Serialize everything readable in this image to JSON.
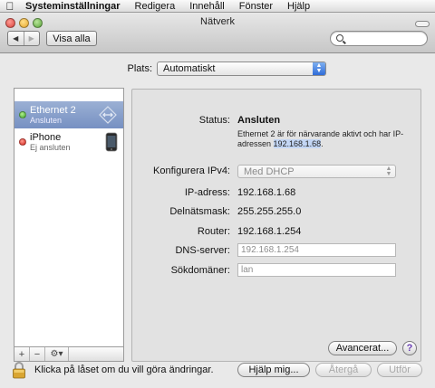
{
  "menubar": {
    "app": "Systeminställningar",
    "items": [
      "Redigera",
      "Innehåll",
      "Fönster",
      "Hjälp"
    ]
  },
  "window": {
    "title": "Nätverk",
    "show_all": "Visa alla",
    "search_placeholder": ""
  },
  "location": {
    "label": "Plats:",
    "value": "Automatiskt"
  },
  "services": [
    {
      "name": "Ethernet 2",
      "status": "Ansluten",
      "state": "connected",
      "selected": true,
      "icon": "ethernet-icon"
    },
    {
      "name": "iPhone",
      "status": "Ej ansluten",
      "state": "disconnected",
      "selected": false,
      "icon": "iphone-icon"
    }
  ],
  "sidebar_controls": {
    "add": "+",
    "remove": "−",
    "action": "⚙▾"
  },
  "detail": {
    "status_label": "Status:",
    "status_value": "Ansluten",
    "status_desc_prefix": "Ethernet 2 är för närvarande aktivt och har IP-adressen ",
    "status_desc_ip": "192.168.1.68",
    "status_desc_suffix": ".",
    "configure_label": "Konfigurera IPv4:",
    "configure_value": "Med DHCP",
    "ip_label": "IP-adress:",
    "ip_value": "192.168.1.68",
    "subnet_label": "Delnätsmask:",
    "subnet_value": "255.255.255.0",
    "router_label": "Router:",
    "router_value": "192.168.1.254",
    "dns_label": "DNS-server:",
    "dns_value": "192.168.1.254",
    "search_domains_label": "Sökdomäner:",
    "search_domains_value": "lan",
    "advanced_button": "Avancerat...",
    "help_button": "?"
  },
  "footer": {
    "lock_text": "Klicka på låset om du vill göra ändringar.",
    "assist_button": "Hjälp mig...",
    "revert_button": "Återgå",
    "apply_button": "Utför"
  },
  "colors": {
    "selection": "#7f97c8",
    "connected": "#3ca52b",
    "disconnected": "#d32219",
    "help_accent": "#6b3fb5"
  }
}
